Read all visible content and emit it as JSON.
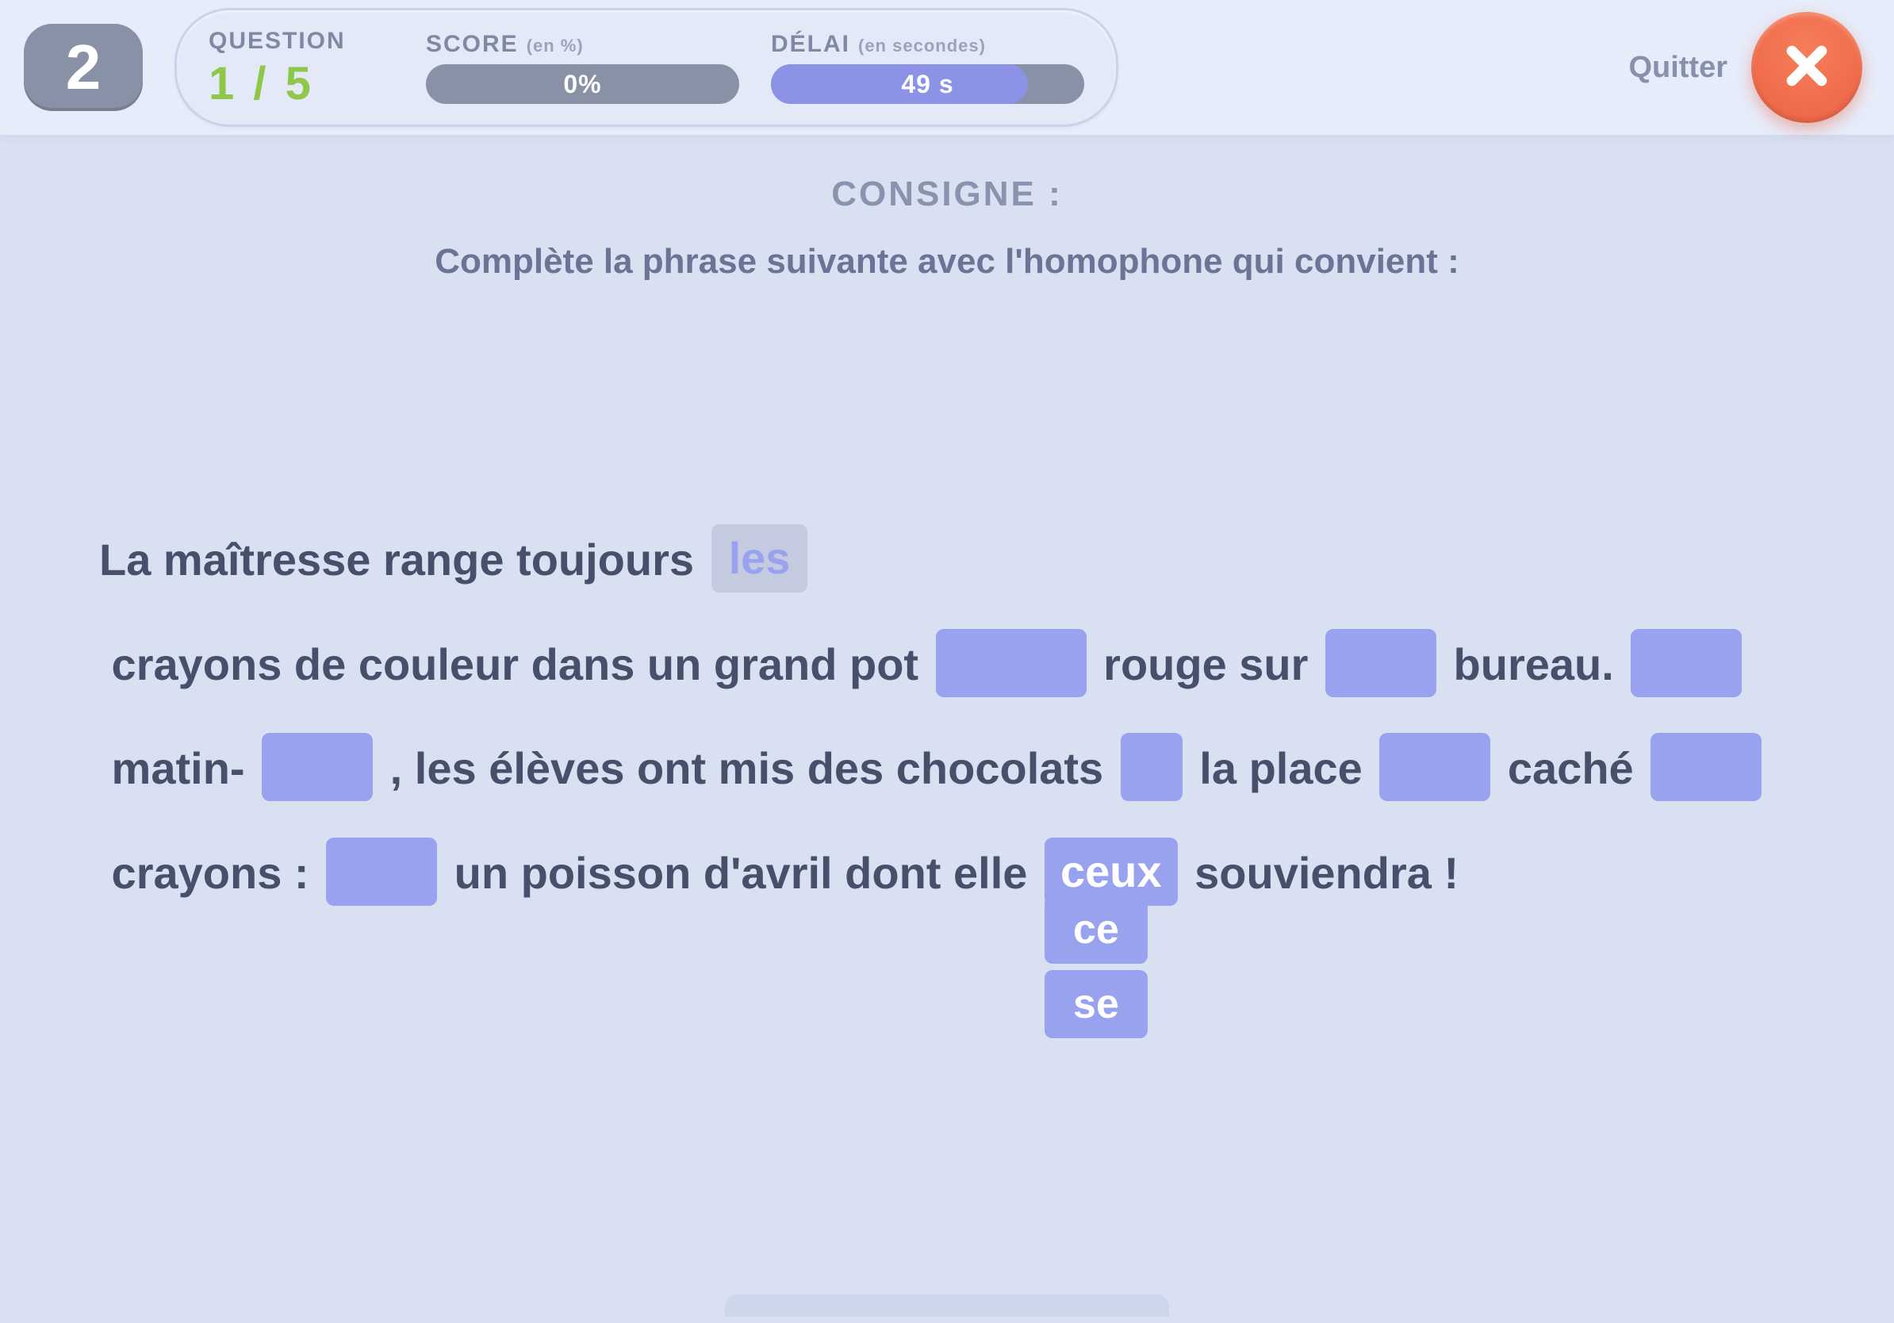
{
  "header": {
    "level_badge": "2",
    "question": {
      "label": "QUESTION",
      "current": "1",
      "sep": "/",
      "total": "5"
    },
    "score": {
      "label": "SCORE",
      "sublabel": "(en %)",
      "value": "0%",
      "percent": 0
    },
    "delay": {
      "label": "DÉLAI",
      "sublabel": "(en secondes)",
      "value": "49 s",
      "percent": 82
    },
    "quit_label": "Quitter"
  },
  "consigne": {
    "title": "CONSIGNE :",
    "text": "Complète la phrase suivante avec l'homophone qui convient :"
  },
  "exercise": {
    "segments": [
      "La maîtresse range toujours ",
      "__BLANK0__",
      " crayons de couleur dans un grand pot ",
      "__BLANK1__",
      " rouge sur ",
      "__BLANK2__",
      " bureau. ",
      "__BLANK3__",
      " matin- ",
      "__BLANK4__",
      " , les élèves ont mis des chocolats ",
      "__BLANK5__",
      " la place ",
      "__BLANK6__",
      " caché ",
      "__BLANK7__",
      " crayons : ",
      "__BLANK8__",
      " un poisson d'avril dont elle ",
      "__BLANK9__",
      " souviendra !"
    ],
    "blanks": {
      "0": {
        "state": "selected",
        "value": "les",
        "size": "auto"
      },
      "1": {
        "state": "empty",
        "size": "big"
      },
      "2": {
        "state": "empty",
        "size": "normal"
      },
      "3": {
        "state": "empty",
        "size": "normal"
      },
      "4": {
        "state": "empty",
        "size": "normal"
      },
      "5": {
        "state": "empty",
        "size": "small"
      },
      "6": {
        "state": "empty",
        "size": "normal"
      },
      "7": {
        "state": "empty",
        "size": "normal"
      },
      "8": {
        "state": "empty",
        "size": "normal"
      },
      "9": {
        "state": "dropdown",
        "current": "ceux",
        "options": [
          "ce",
          "se"
        ]
      }
    }
  }
}
